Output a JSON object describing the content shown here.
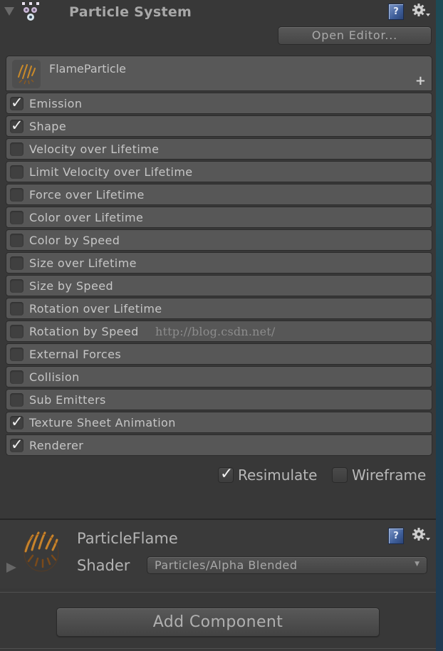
{
  "component": {
    "title": "Particle System",
    "icons": {
      "component": "particle-system-icon",
      "help": "help-icon",
      "settings": "gear-icon"
    },
    "help_glyph": "?",
    "open_editor_label": "Open Editor..."
  },
  "particle_header": {
    "name": "FlameParticle",
    "add_glyph": "+"
  },
  "modules": [
    {
      "label": "Emission",
      "enabled": true
    },
    {
      "label": "Shape",
      "enabled": true
    },
    {
      "label": "Velocity over Lifetime",
      "enabled": false
    },
    {
      "label": "Limit Velocity over Lifetime",
      "enabled": false
    },
    {
      "label": "Force over Lifetime",
      "enabled": false
    },
    {
      "label": "Color over Lifetime",
      "enabled": false
    },
    {
      "label": "Color by Speed",
      "enabled": false
    },
    {
      "label": "Size over Lifetime",
      "enabled": false
    },
    {
      "label": "Size by Speed",
      "enabled": false
    },
    {
      "label": "Rotation over Lifetime",
      "enabled": false
    },
    {
      "label": "Rotation by Speed",
      "enabled": false
    },
    {
      "label": "External Forces",
      "enabled": false
    },
    {
      "label": "Collision",
      "enabled": false
    },
    {
      "label": "Sub Emitters",
      "enabled": false
    },
    {
      "label": "Texture Sheet Animation",
      "enabled": true
    },
    {
      "label": "Renderer",
      "enabled": true
    }
  ],
  "watermark": "http://blog.csdn.net/",
  "check_glyph": "✓",
  "options": {
    "resimulate": {
      "label": "Resimulate",
      "checked": true
    },
    "wireframe": {
      "label": "Wireframe",
      "checked": false
    }
  },
  "material": {
    "name": "ParticleFlame",
    "shader_label": "Shader",
    "shader_value": "Particles/Alpha Blended",
    "dropdown_glyph": "▼",
    "help_glyph": "?"
  },
  "add_component_label": "Add Component"
}
